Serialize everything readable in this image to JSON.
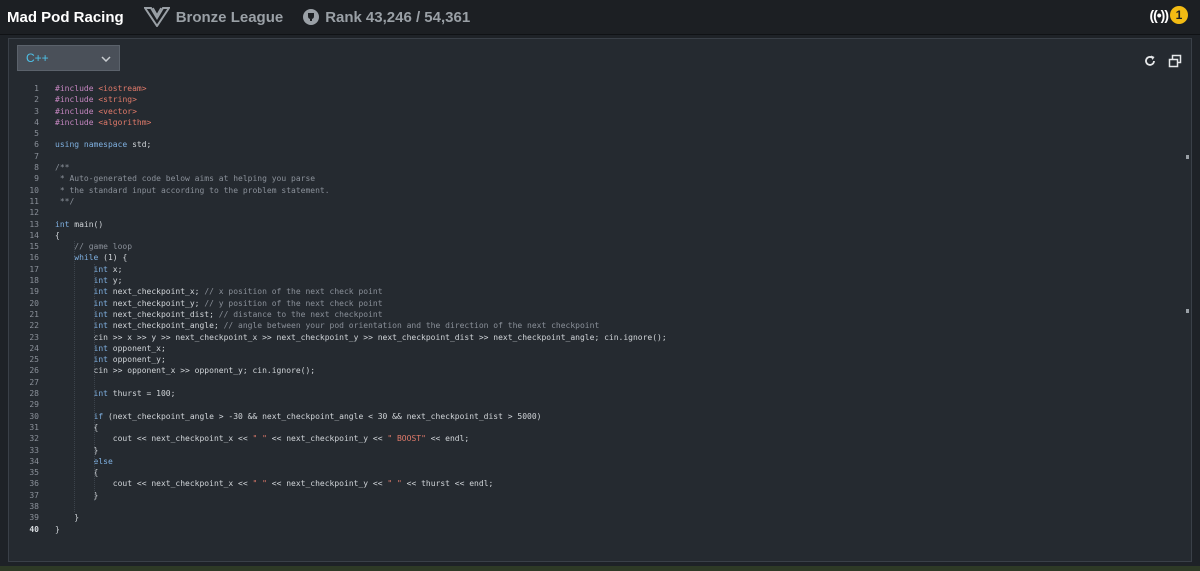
{
  "header": {
    "game_title": "Mad Pod Racing",
    "league": "Bronze League",
    "rank_label": "Rank",
    "rank_value": "43,246 / 54,361",
    "notification_count": "1",
    "broadcast_icon": "broadcast-icon"
  },
  "editor": {
    "language": "C++",
    "active_line": 40,
    "lines": [
      [
        [
          "inc",
          "#include "
        ],
        [
          "str",
          "<iostream>"
        ]
      ],
      [
        [
          "inc",
          "#include "
        ],
        [
          "str",
          "<string>"
        ]
      ],
      [
        [
          "inc",
          "#include "
        ],
        [
          "str",
          "<vector>"
        ]
      ],
      [
        [
          "inc",
          "#include "
        ],
        [
          "str",
          "<algorithm>"
        ]
      ],
      [],
      [
        [
          "kw",
          "using namespace "
        ],
        [
          "pl",
          "std;"
        ]
      ],
      [],
      [
        [
          "cm",
          "/**"
        ]
      ],
      [
        [
          "cm",
          " * Auto-generated code below aims at helping you parse"
        ]
      ],
      [
        [
          "cm",
          " * the standard input according to the problem statement."
        ]
      ],
      [
        [
          "cm",
          " **/"
        ]
      ],
      [],
      [
        [
          "kw",
          "int "
        ],
        [
          "pl",
          "main()"
        ]
      ],
      [
        [
          "pl",
          "{"
        ]
      ],
      [
        [
          "cm",
          "    // game loop"
        ]
      ],
      [
        [
          "kw",
          "    while "
        ],
        [
          "pl",
          "(1) {"
        ]
      ],
      [
        [
          "kw",
          "        int "
        ],
        [
          "pl",
          "x;"
        ]
      ],
      [
        [
          "kw",
          "        int "
        ],
        [
          "pl",
          "y;"
        ]
      ],
      [
        [
          "kw",
          "        int "
        ],
        [
          "pl",
          "next_checkpoint_x; "
        ],
        [
          "cm",
          "// x position of the next check point"
        ]
      ],
      [
        [
          "kw",
          "        int "
        ],
        [
          "pl",
          "next_checkpoint_y; "
        ],
        [
          "cm",
          "// y position of the next check point"
        ]
      ],
      [
        [
          "kw",
          "        int "
        ],
        [
          "pl",
          "next_checkpoint_dist; "
        ],
        [
          "cm",
          "// distance to the next checkpoint"
        ]
      ],
      [
        [
          "kw",
          "        int "
        ],
        [
          "pl",
          "next_checkpoint_angle; "
        ],
        [
          "cm",
          "// angle between your pod orientation and the direction of the next checkpoint"
        ]
      ],
      [
        [
          "pl",
          "        cin >> x >> y >> next_checkpoint_x >> next_checkpoint_y >> next_checkpoint_dist >> next_checkpoint_angle; cin.ignore();"
        ]
      ],
      [
        [
          "kw",
          "        int "
        ],
        [
          "pl",
          "opponent_x;"
        ]
      ],
      [
        [
          "kw",
          "        int "
        ],
        [
          "pl",
          "opponent_y;"
        ]
      ],
      [
        [
          "pl",
          "        cin >> opponent_x >> opponent_y; cin.ignore();"
        ]
      ],
      [],
      [
        [
          "kw",
          "        int "
        ],
        [
          "pl",
          "thurst = 100;"
        ]
      ],
      [],
      [
        [
          "kw",
          "        if "
        ],
        [
          "pl",
          "(next_checkpoint_angle > -30 && next_checkpoint_angle < 30 && next_checkpoint_dist > 5000)"
        ]
      ],
      [
        [
          "pl",
          "        {"
        ]
      ],
      [
        [
          "pl",
          "            cout << next_checkpoint_x << "
        ],
        [
          "str",
          "\" \""
        ],
        [
          "pl",
          " << next_checkpoint_y << "
        ],
        [
          "str",
          "\" BOOST\""
        ],
        [
          "pl",
          " << endl;"
        ]
      ],
      [
        [
          "pl",
          "        }"
        ]
      ],
      [
        [
          "kw",
          "        else"
        ]
      ],
      [
        [
          "pl",
          "        {"
        ]
      ],
      [
        [
          "pl",
          "            cout << next_checkpoint_x << "
        ],
        [
          "str",
          "\" \""
        ],
        [
          "pl",
          " << next_checkpoint_y << "
        ],
        [
          "str",
          "\" \""
        ],
        [
          "pl",
          " << thurst << endl;"
        ]
      ],
      [
        [
          "pl",
          "        }"
        ]
      ],
      [],
      [
        [
          "pl",
          "    }"
        ]
      ],
      [
        [
          "pl",
          "}"
        ]
      ]
    ]
  },
  "colors": {
    "accent": "#4ec1e8",
    "badge": "#f2bb13",
    "keyword": "#7fb0e0",
    "string": "#e07a6a",
    "comment": "#8a9099"
  }
}
